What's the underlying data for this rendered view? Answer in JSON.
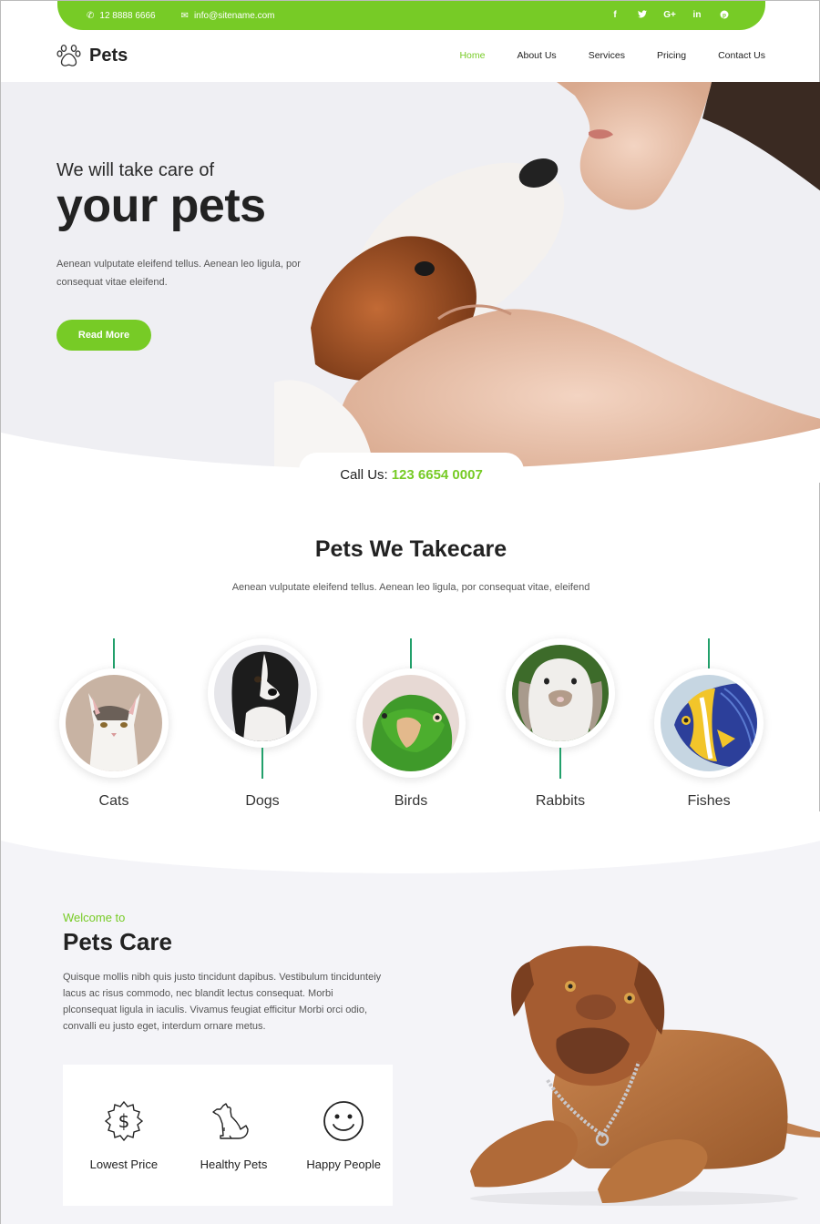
{
  "topbar": {
    "phone": "12 8888 6666",
    "email": "info@sitename.com",
    "social": [
      {
        "name": "facebook-icon",
        "glyph": "f"
      },
      {
        "name": "twitter-icon",
        "glyph": "🐦"
      },
      {
        "name": "google-plus-icon",
        "glyph": "G+"
      },
      {
        "name": "linkedin-icon",
        "glyph": "in"
      },
      {
        "name": "pinterest-icon",
        "glyph": "℗"
      }
    ]
  },
  "header": {
    "logo_text": "Pets",
    "nav": [
      {
        "label": "Home",
        "active": true
      },
      {
        "label": "About Us"
      },
      {
        "label": "Services"
      },
      {
        "label": "Pricing"
      },
      {
        "label": "Contact Us"
      }
    ]
  },
  "hero": {
    "subtitle": "We will take care of",
    "title": "your pets",
    "description": "Aenean vulputate eleifend tellus. Aenean leo ligula, por consequat vitae eleifend.",
    "button_label": "Read More"
  },
  "callus": {
    "label": "Call Us:",
    "number": "123 6654 0007"
  },
  "pets_section": {
    "title": "Pets We Takecare",
    "subtitle": "Aenean vulputate eleifend tellus. Aenean leo ligula, por consequat vitae, eleifend",
    "pets": [
      {
        "label": "Cats"
      },
      {
        "label": "Dogs"
      },
      {
        "label": "Birds"
      },
      {
        "label": "Rabbits"
      },
      {
        "label": "Fishes"
      }
    ]
  },
  "welcome": {
    "small": "Welcome to",
    "title": "Pets Care",
    "text": "Quisque mollis nibh quis justo tincidunt dapibus. Vestibulum tincidunteiy lacus ac risus commodo, nec blandit lectus consequat. Morbi plconsequat ligula in iaculis. Vivamus feugiat efficitur Morbi orci odio, convalli eu justo eget, interdum ornare metus.",
    "features": [
      {
        "label": "Lowest Price",
        "icon": "dollar-badge-icon"
      },
      {
        "label": "Healthy Pets",
        "icon": "dog-icon"
      },
      {
        "label": "Happy People",
        "icon": "smiley-icon"
      }
    ]
  },
  "colors": {
    "accent": "#77cb26",
    "pet_line": "#22a06b",
    "section_bg": "#f4f4f8",
    "text_dark": "#222222"
  }
}
